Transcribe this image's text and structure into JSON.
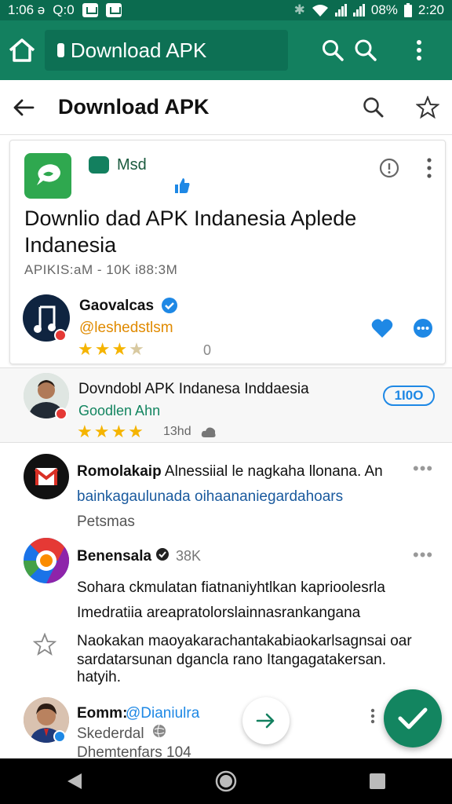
{
  "status_bar": {
    "left_text": "1:06 ə",
    "left_text2": "Q:0",
    "battery": "08%",
    "time": "2:20"
  },
  "app_bar": {
    "omnibox_text": "Download APK"
  },
  "toolbar": {
    "title": "Download APK"
  },
  "card": {
    "meta_label": "Msd",
    "title": "Downlio dad APK Indanesia Aplede Indanesia",
    "subtitle": "APIKIS:aM  -  10K i88:3M",
    "author_name": "Gaovalcas",
    "author_handle": "@leshedstlsm",
    "rating_stars": 3,
    "rating_count": "0"
  },
  "section2": {
    "title": "Dovndobl APK Indanesa Inddaesia",
    "subtitle": "Goodlen Ahn",
    "rating_stars": 4,
    "rating_meta": "13hd",
    "badge": "1I0O"
  },
  "list": [
    {
      "name": "Romolakaip",
      "title_rest": " Alnessiial le nagkaha llonana. An",
      "link": "bainkagaulunada oihaananiegardahoars",
      "footer": "Petsmas"
    },
    {
      "name": "Benensala",
      "count": "38K",
      "body1": "Sohara ckmulatan fiatnaniyhtlkan kaprioolesrla",
      "body2": "Imedratiia areapratolorslainnasrankangana",
      "body3": "Naokakan maoyakarachantakabiaokarlsagnsai oar",
      "body4": "sardatarsunan dgancla rano Itangagatakersan.",
      "body5": "hatyih."
    },
    {
      "name": "Eomm:",
      "handle": "@Dianiulra",
      "sub": "Skederdal",
      "footer": "Dhemtenfars 104"
    }
  ],
  "colors": {
    "primary": "#13805f",
    "primary_dark": "#0b6b4f",
    "accent_blue": "#1e88e5",
    "star": "#f5b400"
  }
}
